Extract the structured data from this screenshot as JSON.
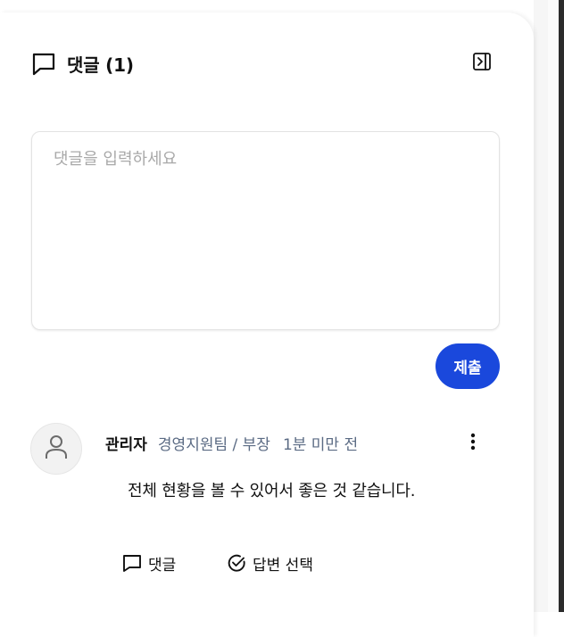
{
  "header": {
    "title": "댓글 (1)",
    "icon": "comment-icon",
    "collapse_icon": "panel-collapse-icon"
  },
  "composer": {
    "placeholder": "댓글을 입력하세요",
    "value": "",
    "submit_label": "제출"
  },
  "colors": {
    "accent": "#1a48dc",
    "meta_text": "#5b6b84",
    "placeholder": "#a9a9a9"
  },
  "comments": [
    {
      "author": "관리자",
      "department": "경영지원팀 / 부장",
      "time": "1분 미만 전",
      "text": "전체 현황을 볼 수 있어서 좋은 것 같습니다.",
      "avatar_icon": "user-icon",
      "more_icon": "more-vertical-icon",
      "actions": {
        "reply_label": "댓글",
        "reply_icon": "comment-icon",
        "select_answer_label": "답변 선택",
        "select_answer_icon": "check-circle-icon"
      }
    }
  ]
}
